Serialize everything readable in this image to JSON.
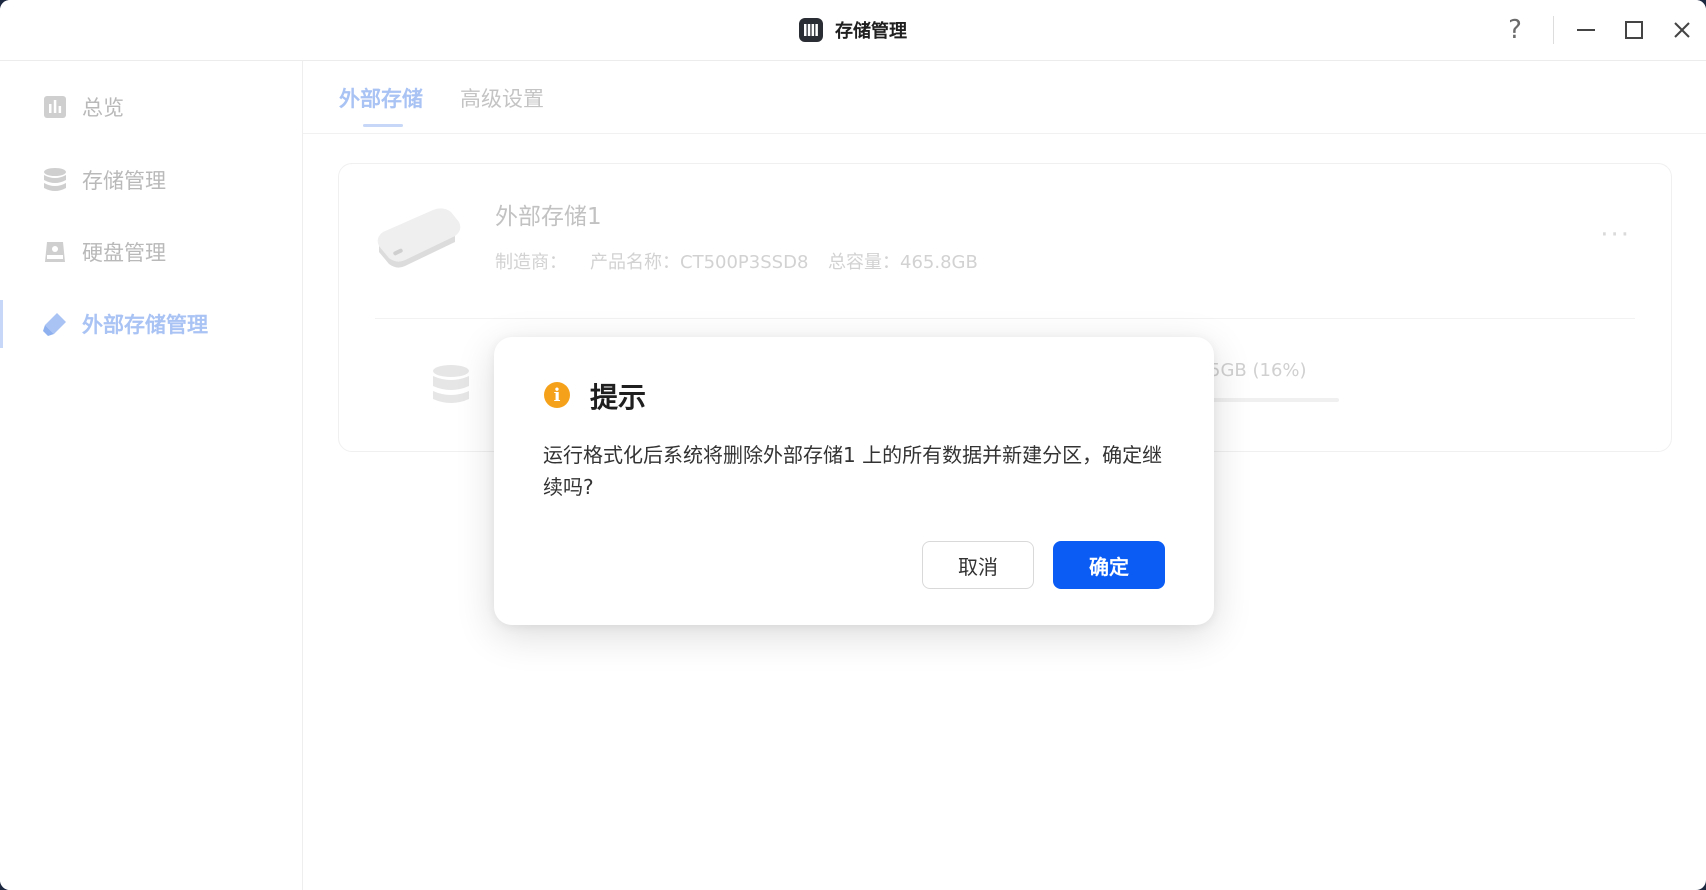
{
  "window": {
    "title": "存储管理",
    "help_label": "?"
  },
  "sidebar": {
    "items": [
      {
        "label": "总览",
        "icon": "chart-icon"
      },
      {
        "label": "存储管理",
        "icon": "database-icon"
      },
      {
        "label": "硬盘管理",
        "icon": "disk-icon"
      },
      {
        "label": "外部存储管理",
        "icon": "usb-drive-icon",
        "active": true
      }
    ]
  },
  "tabs": [
    {
      "label": "外部存储",
      "active": true
    },
    {
      "label": "高级设置",
      "active": false
    }
  ],
  "storage_card": {
    "title": "外部存储1",
    "manufacturer": "制造商：",
    "product_name": "产品名称：CT500P3SSD8",
    "capacity": "总容量：465.8GB",
    "more": "···",
    "usage_partial": "5GB (16%)"
  },
  "dialog": {
    "title": "提示",
    "icon_glyph": "i",
    "message": "运行格式化后系统将删除外部存储1 上的所有数据并新建分区，确定继续吗?",
    "cancel_label": "取消",
    "confirm_label": "确定"
  },
  "colors": {
    "accent": "#0a5cf5",
    "warning": "#f5a21a"
  }
}
